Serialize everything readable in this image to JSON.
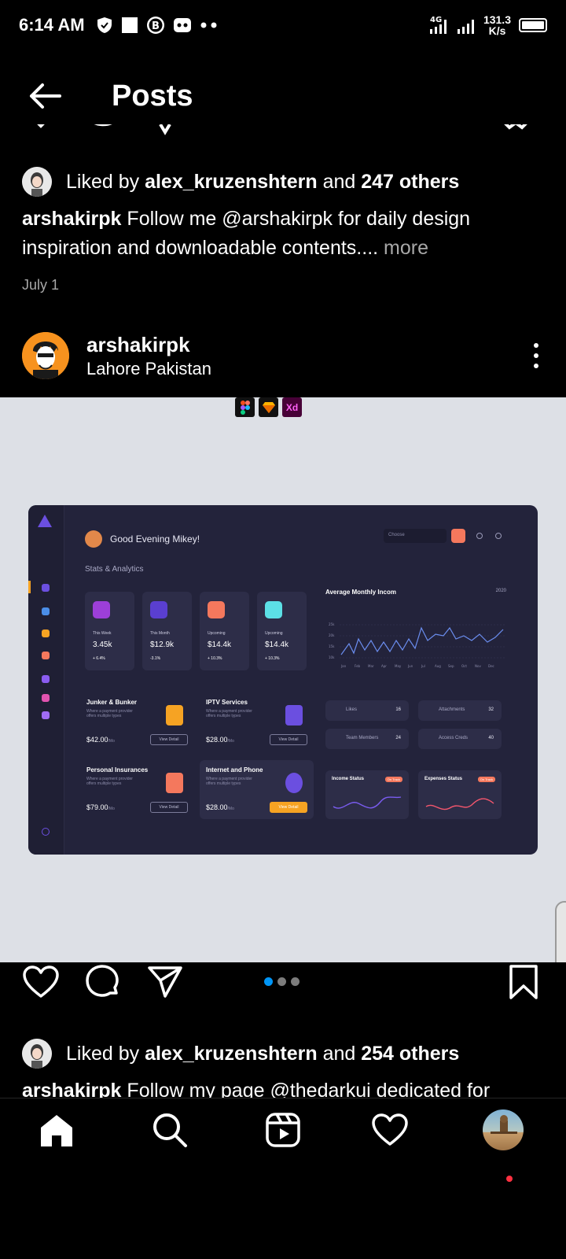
{
  "status_bar": {
    "time": "6:14 AM",
    "network": "4G",
    "speed_value": "131.3",
    "speed_unit": "K/s"
  },
  "header": {
    "title": "Posts"
  },
  "prev_post": {
    "liked_prefix": "Liked by",
    "liked_user": "alex_kruzenshtern",
    "liked_and": "and",
    "liked_others": "247 others",
    "caption_user": "arshakirpk",
    "caption_text": "Follow me @arshakirpk for daily design inspiration and downloadable contents....",
    "more_label": "more",
    "date": "July 1"
  },
  "post": {
    "username": "arshakirpk",
    "location": "Lahore Pakistan",
    "tool_badges": [
      "figma-icon",
      "sketch-icon",
      "Xd"
    ],
    "dashboard": {
      "greeting": "Good Evening Mikey!",
      "section": "Stats & Analytics",
      "choose": "Choose",
      "stats": [
        {
          "label": "This Week",
          "value": "3.45k",
          "delta": "+ 6.4%"
        },
        {
          "label": "This Month",
          "value": "$12.9k",
          "delta": "-3.1%"
        },
        {
          "label": "Upcoming",
          "value": "$14.4k",
          "delta": "+ 10.3%"
        },
        {
          "label": "Upcoming",
          "value": "$14.4k",
          "delta": "+ 10.3%"
        }
      ],
      "chart_title": "Average Monthly Incom",
      "chart_year": "2020",
      "chart_y_ticks": [
        "25k",
        "20k",
        "15k",
        "10k"
      ],
      "chart_months": [
        "Jan",
        "Feb",
        "Mar",
        "Apr",
        "May",
        "Jun",
        "Jul",
        "Aug",
        "Sep",
        "Oct",
        "Nov",
        "Dec"
      ],
      "services": [
        {
          "name": "Junker & Bunker",
          "desc": "Where a payment provider offers multiple types",
          "price": "$42.00",
          "unit": "/Mo",
          "button": "View Detail"
        },
        {
          "name": "IPTV Services",
          "desc": "Where a payment provider offers multiple types",
          "price": "$28.00",
          "unit": "/Mo",
          "button": "View Detail"
        },
        {
          "name": "Personal Insurances",
          "desc": "Where a payment provider offers multiple types",
          "price": "$79.00",
          "unit": "/Mo",
          "button": "View Detail"
        },
        {
          "name": "Internet and Phone",
          "desc": "Where a payment provider offers multiple types",
          "price": "$28.00",
          "unit": "/Mo",
          "button": "View Detail"
        }
      ],
      "mini_stats": [
        {
          "label": "Likes",
          "value": "16"
        },
        {
          "label": "Attachments",
          "value": "32"
        },
        {
          "label": "Team Members",
          "value": "24"
        },
        {
          "label": "Access Creds",
          "value": "40"
        }
      ],
      "status_cards": [
        {
          "title": "Income Status",
          "pill": "On Track"
        },
        {
          "title": "Expenses Status",
          "pill": "On Track"
        }
      ]
    },
    "liked_prefix": "Liked by",
    "liked_user": "alex_kruzenshtern",
    "liked_and": "and",
    "liked_others": "254 others",
    "caption_user": "arshakirpk",
    "caption_text": "Follow my page @thedarkui dedicated for"
  },
  "colors": {
    "accent_blue": "#0095f6",
    "notification": "#ff3040",
    "image_bg": "#dde0e6",
    "dashboard_bg": "#23233b"
  }
}
